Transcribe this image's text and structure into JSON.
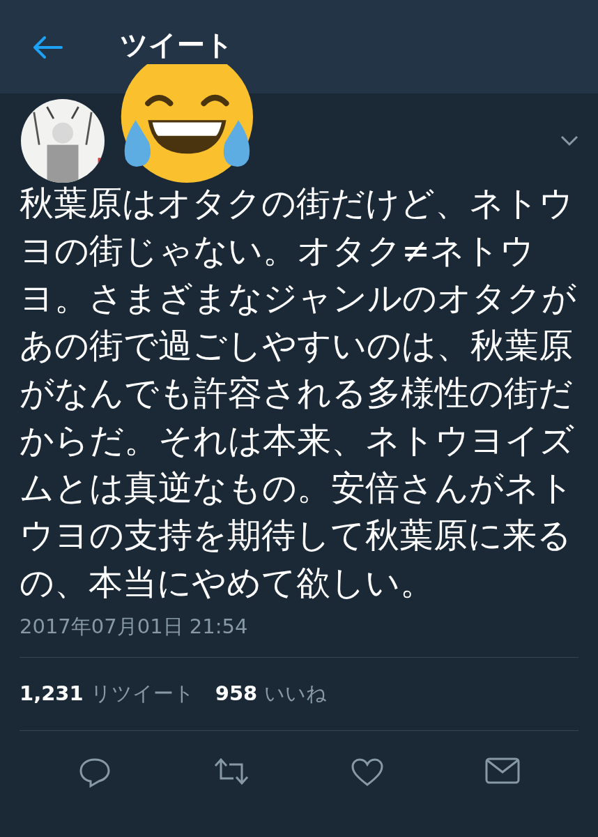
{
  "header": {
    "title": "ツイート"
  },
  "tweet": {
    "text": "秋葉原はオタクの街だけど、ネトウヨの街じゃない。オタク≠ネトウヨ。さまざまなジャンルのオタクがあの街で過ごしやすいのは、秋葉原がなんでも許容される多様性の街だからだ。それは本来、ネトウヨイズムとは真逆なもの。安倍さんがネトウヨの支持を期待して秋葉原に来るの、本当にやめて欲しい。",
    "timestamp": "2017年07月01日 21:54"
  },
  "stats": [
    {
      "count": "1,231",
      "label": "リツイート"
    },
    {
      "count": "958",
      "label": "いいね"
    }
  ]
}
